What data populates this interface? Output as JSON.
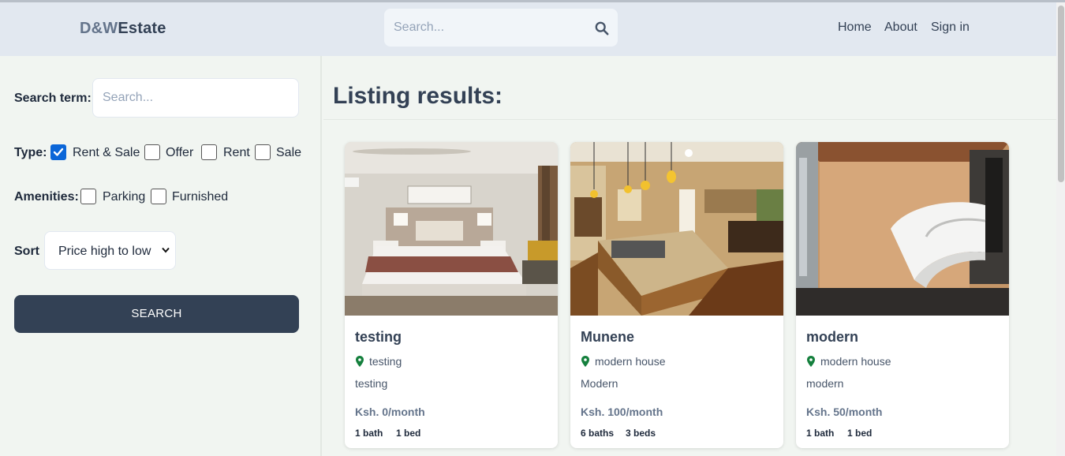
{
  "header": {
    "logo_part1": "D&W",
    "logo_part2": "Estate",
    "search_placeholder": "Search...",
    "nav": [
      "Home",
      "About",
      "Sign in"
    ]
  },
  "filters": {
    "search_term_label": "Search term:",
    "search_term_placeholder": "Search...",
    "type_label": "Type:",
    "type_options": [
      {
        "label": "Rent & Sale",
        "checked": true
      },
      {
        "label": "Offer",
        "checked": false
      },
      {
        "label": "Rent",
        "checked": false
      },
      {
        "label": "Sale",
        "checked": false
      }
    ],
    "amenities_label": "Amenities:",
    "amenities_options": [
      {
        "label": "Parking",
        "checked": false
      },
      {
        "label": "Furnished",
        "checked": false
      }
    ],
    "sort_label": "Sort",
    "sort_value": "Price high to low",
    "search_button": "SEARCH"
  },
  "results": {
    "title": "Listing results:",
    "listings": [
      {
        "name": "testing",
        "address": "testing",
        "description": "testing",
        "price": "Ksh. 0/month",
        "baths": "1 bath",
        "beds": "1 bed",
        "image": "bedroom"
      },
      {
        "name": "Munene",
        "address": "modern house",
        "description": "Modern",
        "price": "Ksh. 100/month",
        "baths": "6 baths",
        "beds": "3 beds",
        "image": "kitchen"
      },
      {
        "name": "modern",
        "address": "modern house",
        "description": "modern",
        "price": "Ksh. 50/month",
        "baths": "1 bath",
        "beds": "1 bed",
        "image": "staircase"
      }
    ]
  },
  "colors": {
    "header_bg": "#e2e8f0",
    "page_bg": "#f1f5f1",
    "button_bg": "#334155",
    "pin": "#15803d",
    "checkbox": "#0b66d8"
  }
}
